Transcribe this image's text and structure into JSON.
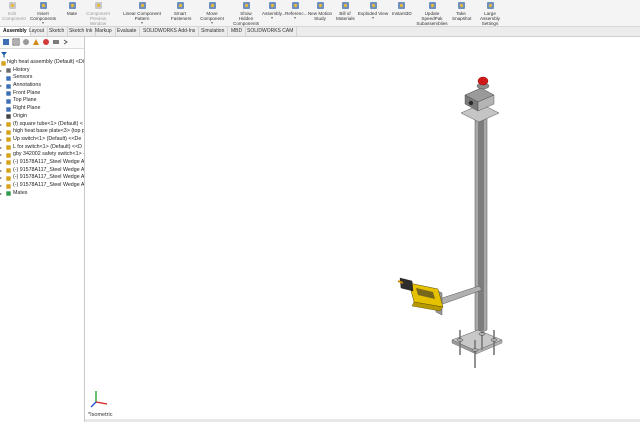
{
  "ribbon": {
    "buttons": [
      {
        "label": "Edit Component",
        "disabled": true,
        "icon": "edit-component-icon"
      },
      {
        "label": "Insert Components",
        "chevron": "▾",
        "icon": "insert-components-icon"
      },
      {
        "label": "Mate",
        "icon": "mate-icon"
      },
      {
        "label": "Component Preview Window",
        "disabled": true,
        "icon": "component-preview-icon"
      },
      {
        "label": "Linear Component Pattern",
        "chevron": "▾",
        "icon": "linear-pattern-icon"
      },
      {
        "label": "Smart Fasteners",
        "icon": "smart-fasteners-icon"
      },
      {
        "label": "Move Component",
        "chevron": "▾",
        "icon": "move-component-icon"
      },
      {
        "label": "Show Hidden Components",
        "icon": "show-hidden-icon"
      },
      {
        "label": "Assembly...",
        "chevron": "▾",
        "icon": "assembly-features-icon"
      },
      {
        "label": "Referenc...",
        "chevron": "▾",
        "icon": "reference-geometry-icon"
      },
      {
        "label": "New Motion Study",
        "icon": "motion-study-icon"
      },
      {
        "label": "Bill of Materials",
        "icon": "bom-icon"
      },
      {
        "label": "Exploded View",
        "chevron": "▾",
        "icon": "exploded-view-icon"
      },
      {
        "label": "Instant3D",
        "icon": "instant3d-icon"
      },
      {
        "label": "Update SpeedPak Subassemblies",
        "icon": "speedpak-icon"
      },
      {
        "label": "Take Snapshot",
        "icon": "snapshot-icon"
      },
      {
        "label": "Large Assembly Settings",
        "chevron": "▾",
        "icon": "large-assembly-icon"
      }
    ]
  },
  "tabs": [
    "Assembly",
    "Layout",
    "Sketch",
    "Sketch Ink",
    "Markup",
    "Evaluate",
    "SOLIDWORKS Add-Ins",
    "Simulation",
    "MBD",
    "SOLIDWORKS CAM"
  ],
  "tree": [
    {
      "label": "high heat assembly (Default) <Di",
      "icon": "assembly-icon",
      "level": 0,
      "expand": ""
    },
    {
      "label": "History",
      "icon": "history-icon",
      "level": 1,
      "expand": "▸"
    },
    {
      "label": "Sensors",
      "icon": "sensors-icon",
      "level": 1,
      "expand": ""
    },
    {
      "label": "Annotations",
      "icon": "annotations-icon",
      "level": 1,
      "expand": "▸"
    },
    {
      "label": "Front Plane",
      "icon": "plane-icon",
      "level": 1,
      "expand": ""
    },
    {
      "label": "Top Plane",
      "icon": "plane-icon",
      "level": 1,
      "expand": ""
    },
    {
      "label": "Right Plane",
      "icon": "plane-icon",
      "level": 1,
      "expand": ""
    },
    {
      "label": "Origin",
      "icon": "origin-icon",
      "level": 1,
      "expand": ""
    },
    {
      "label": "(f) square tube<1> (Default) <",
      "icon": "part-icon",
      "level": 1,
      "expand": "▸"
    },
    {
      "label": "high heat base plate<3> (top pla",
      "icon": "part-icon",
      "level": 1,
      "expand": "▸"
    },
    {
      "label": "Up switch<1> (Default) <<De",
      "icon": "subassembly-icon",
      "level": 1,
      "expand": "▸"
    },
    {
      "label": "L for switch<1> (Default) <<D",
      "icon": "part-icon",
      "level": 1,
      "expand": "▸"
    },
    {
      "label": "gby 342002 safety switch<1> -",
      "icon": "part-icon",
      "level": 1,
      "expand": "▸"
    },
    {
      "label": "(-) 91578A117_Steel Wedge A",
      "icon": "part-icon",
      "level": 1,
      "expand": "▸"
    },
    {
      "label": "(-) 91578A117_Steel Wedge A",
      "icon": "part-icon",
      "level": 1,
      "expand": "▸"
    },
    {
      "label": "(-) 91578A117_Steel Wedge A",
      "icon": "part-icon",
      "level": 1,
      "expand": "▸"
    },
    {
      "label": "(-) 91578A117_Steel Wedge A",
      "icon": "part-icon",
      "level": 1,
      "expand": "▸"
    },
    {
      "label": "Mates",
      "icon": "mates-icon",
      "level": 1,
      "expand": "▸"
    }
  ],
  "viewport": {
    "view_label": "*Isometric"
  },
  "filter_icon": "funnel-icon",
  "colors": {
    "accent": "#1f5fa8",
    "feature_blue": "#2e66b0",
    "part_yellow": "#e5c100",
    "button_red": "#d01818"
  }
}
